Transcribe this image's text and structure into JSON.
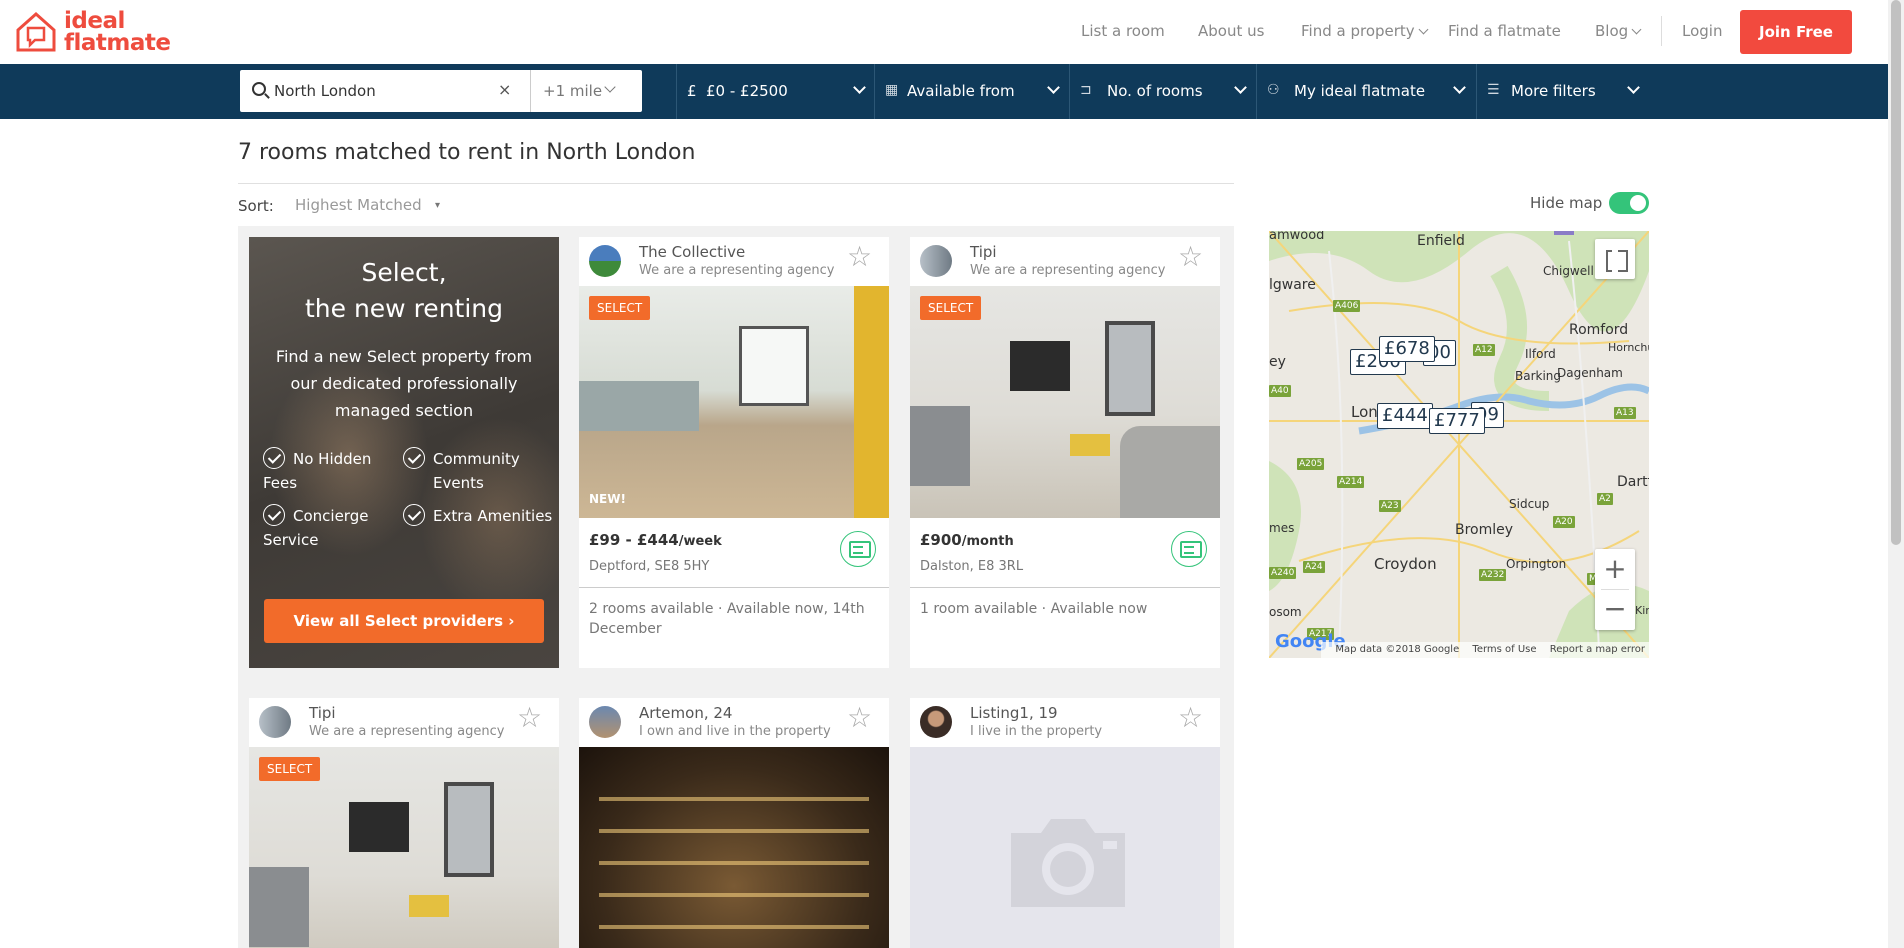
{
  "header": {
    "logo_line1": "ideal",
    "logo_line2": "flatmate",
    "nav": [
      "List a room",
      "About us",
      "Find a property",
      "Find a flatmate",
      "Blog"
    ],
    "login": "Login",
    "join": "Join Free"
  },
  "filters": {
    "location": "North London",
    "clear": "×",
    "radius": "+1 mile",
    "price": "£0 - £2500",
    "available": "Available from",
    "rooms": "No. of rooms",
    "flatmate": "My ideal flatmate",
    "more": "More filters"
  },
  "results": {
    "title": "7 rooms matched to rent in North London",
    "sort_label": "Sort:",
    "sort_value": "Highest Matched",
    "sort_caret": "▾"
  },
  "map_toggle": {
    "label": "Hide map",
    "on": true
  },
  "promo": {
    "title_line1": "Select,",
    "title_line2": "the new renting",
    "desc": "Find a new Select property from our dedicated professionally managed section",
    "features": [
      "No Hidden Fees",
      "Community Events",
      "Concierge Service",
      "Extra Amenities"
    ],
    "button": "View all Select providers ›"
  },
  "listings": [
    {
      "name": "The Collective",
      "role": "We are a representing agency",
      "badge": "SELECT",
      "new_tag": "NEW!",
      "price": "£99 - £444",
      "period": "/week",
      "address": "Deptford, SE8 5HY",
      "availability": "2 rooms available · Available now, 14th December"
    },
    {
      "name": "Tipi",
      "role": "We are a representing agency",
      "badge": "SELECT",
      "price": "£900",
      "period": "/month",
      "address": "Dalston, E8 3RL",
      "availability": "1 room available · Available now"
    },
    {
      "name": "Tipi",
      "role": "We are a representing agency",
      "badge": "SELECT"
    },
    {
      "name": "Artemon, 24",
      "role": "I own and live in the property"
    },
    {
      "name": "Listing1, 19",
      "role": "I live in the property"
    }
  ],
  "map": {
    "places": [
      "amwood",
      "Enfield",
      "Chigwell",
      "lgware",
      "Romford",
      "Hornchur",
      "Ilford",
      "Barking",
      "Dagenham",
      "ey",
      "Lon",
      "Dartfor",
      "Sidcup",
      "mes",
      "Bromley",
      "Croydon",
      "Orpington",
      "osom",
      "Kir"
    ],
    "roads": [
      "A406",
      "A12",
      "A40",
      "A13",
      "A205",
      "A214",
      "A23",
      "A2",
      "A20",
      "A240",
      "A24",
      "A232",
      "M25",
      "A217"
    ],
    "pins": [
      "£678",
      "£200",
      "00",
      "£444",
      "99",
      "£777"
    ],
    "zoom_in": "+",
    "zoom_out": "−",
    "google": "Google",
    "attribution": [
      "Map data ©2018 Google",
      "Terms of Use",
      "Report a map error"
    ]
  },
  "colors": {
    "brand": "#ee4c3e",
    "navy": "#0f3a5a",
    "select_orange": "#f26b2a",
    "toggle_green": "#34c47a"
  }
}
